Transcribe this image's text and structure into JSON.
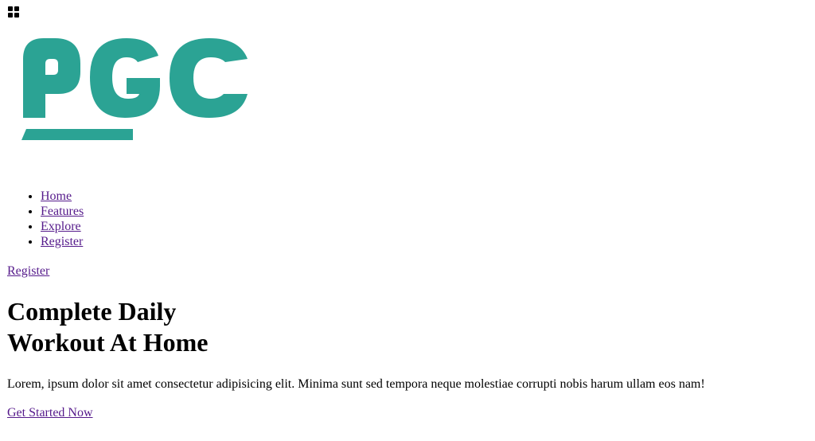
{
  "header": {
    "menu_icon": "grid-four-squares-icon",
    "logo": {
      "text": "PGC",
      "color": "#2ba394"
    },
    "nav": [
      {
        "label": "Home"
      },
      {
        "label": "Features"
      },
      {
        "label": "Explore"
      },
      {
        "label": "Register"
      }
    ],
    "register_link": "Register"
  },
  "hero": {
    "title_line1": "Complete Daily",
    "title_line2": "Workout At Home",
    "description": "Lorem, ipsum dolor sit amet consectetur adipisicing elit. Minima sunt sed tempora neque molestiae corrupti nobis harum ullam eos nam!",
    "cta_label": "Get Started Now"
  },
  "colors": {
    "link_visited": "#551a8b",
    "text": "#000000",
    "background": "#ffffff"
  }
}
